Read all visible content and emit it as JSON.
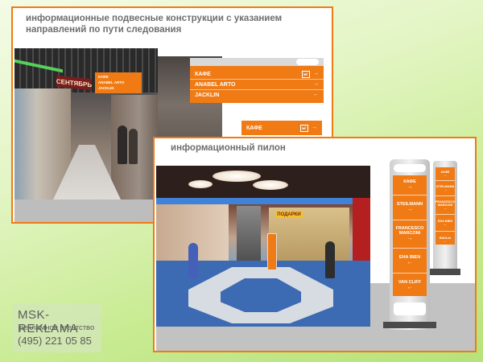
{
  "panel1": {
    "title_line1": "информационные подвесные конструкции с указанием",
    "title_line2": "направлений по пути следования",
    "small_sign_items": [
      "КАФЕ",
      "ANABEL ARTO",
      "JACKLIN"
    ],
    "main_sign_items": [
      {
        "label": "КАФЕ",
        "icon": "cafe-cup-icon",
        "arrow": "→"
      },
      {
        "label": "ANABEL ARTO",
        "arrow": "→"
      },
      {
        "label": "JACKLIN",
        "arrow": "←"
      }
    ],
    "lower_sign": {
      "label": "КАФЕ",
      "icon": "cafe-cup-icon",
      "arrow": "→"
    },
    "store_sign": "СЕНТЯБРЬ"
  },
  "panel2": {
    "title": "информационный пилон",
    "pylon_large_items": [
      {
        "label": "КАФЕ",
        "arrow": "→"
      },
      {
        "label": "STEILMANN",
        "arrow": "→"
      },
      {
        "label": "FRANCESCO MARCONI",
        "arrow": "→"
      },
      {
        "label": "ЕНА BIEN",
        "arrow": "←"
      },
      {
        "label": "VAN CLIFF",
        "arrow": "←"
      }
    ],
    "pylon_small_items": [
      {
        "label": "КАФЕ",
        "arrow": "→"
      },
      {
        "label": "STEILMANN",
        "arrow": "→"
      },
      {
        "label": "FRANCESCO MARCONI",
        "arrow": "→"
      },
      {
        "label": "ЕНА BIEN",
        "arrow": "←"
      },
      {
        "label": "BAULIA",
        "arrow": "←"
      }
    ],
    "store_sign": "ПОДАРКИ"
  },
  "footer": {
    "brand": "MSK-REKLAMA",
    "tagline": "рекламное агентство",
    "phone": "(495) 221 05 85"
  },
  "colors": {
    "accent": "#f07a14",
    "text_gray": "#6e6e6e"
  }
}
